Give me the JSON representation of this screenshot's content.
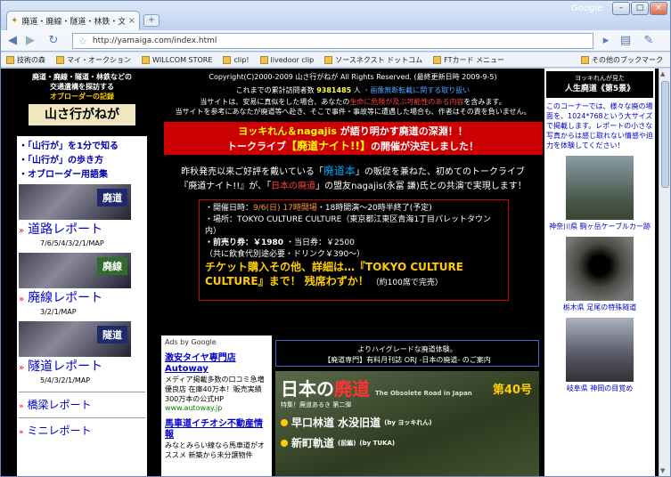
{
  "browser": {
    "tab_title": "廃道・廃線・隧道・林鉄・文…",
    "tab_close": "×",
    "new_tab": "+",
    "brand": "Google",
    "win_min": "–",
    "win_max": "□",
    "win_close": "×",
    "url": "http://yamaiga.com/index.html",
    "bookmarks": [
      "技術の森",
      "マイ・オークション",
      "WILLCOM STORE",
      "clip!",
      "livedoor clip",
      "ソースネクスト ドットコム",
      "FTカード メニュー",
      "その他のブックマーク"
    ]
  },
  "left": {
    "logo_line1": "廃道・廃線・隧道・林鉄などの",
    "logo_line2": "交通遺構を探訪する",
    "logo_orange": "オブローダーの記録",
    "logo_name": "山さ行がねが",
    "links": [
      "・「山行が」を1分で知る",
      "・「山行が」の歩き方",
      "・オブローダー用語集"
    ],
    "cat1": "廃道",
    "rep1": "道路レポート",
    "sub1": "7/6/5/4/3/2/1/MAP",
    "cat2": "廃線",
    "rep2": "廃線レポート",
    "sub2": "3/2/1/MAP",
    "cat3": "隧道",
    "rep3": "隧道レポート",
    "sub3": "5/4/3/2/1/MAP",
    "rep4": "橋梁レポート",
    "rep5": "ミニレポート",
    "marker": "»"
  },
  "center": {
    "copyright": "Copyright(C)2000-2009 山さ行がねが All Rights Reserved. (最終更新日時 2009-9-5)",
    "visitors_pre": "これまでの累計訪問者数",
    "visitors_count": "9381485",
    "visitors_post": "人",
    "visitors_link": "・画像無断転載に関する取り扱い",
    "note1a": "当サイトは、安易に真似をした場合、あなたの",
    "note1b": "生命に危険が及ぶ可能性のある内容",
    "note1c": "を含みます。",
    "note2": "当サイトを参考にあなたが廃道等へ赴き、そこで事件・事故等に遭遇した場合も、作者はその責を負いません。",
    "banner1a": "ヨッキれん＆nagajis",
    "banner1b": "が語り明かす廃道の深淵！！",
    "banner2a": "トークライブ",
    "banner2b": "【廃道ナイト!!】",
    "banner2c": "の開催が決定しました！",
    "intro1a": "昨秋発売以来ご好評を戴いている「",
    "intro1b": "廃道本",
    "intro1c": "」の販促を兼ねた、初めてのトークライブ",
    "intro2a": "『廃道ナイト!!』が、「",
    "intro2b": "日本の廃道",
    "intro2c": "」の盟友nagajis(永冨 謙)氏との共演で実現します！",
    "info_date_a": "・開催日時：",
    "info_date_b": "9/6(日) 17時開場",
    "info_date_c": "・18時開演～20時半終了(予定)",
    "info_place": "・場所：TOKYO CULTURE CULTURE（東京都江東区青海1丁目パレットタウン内）",
    "info_price_a": "・前売り券：￥1980",
    "info_price_b": "・当日券：￥2500",
    "info_price_note": "（共に飲食代別途必要・ドリンク￥390～）",
    "info_ticket_a": "チケット購入その他、詳細は…『TOKYO CULTURE CULTURE』まで！ 残席わずか！",
    "info_ticket_b": "（約100席で完売）",
    "ads_by": "Ads by Google",
    "ad1_title": "激安タイヤ専門店 Autoway",
    "ad1_body": "メディア掲載多数の口コミ急増優良店 在庫40万本！販売実績300万本の公式HP",
    "ad1_url": "www.autoway.jp",
    "ad2_title": "馬車道イチオシ不動産情報",
    "ad2_body": "みなとみらい線なら馬車道がオススメ 新築から未分譲物件",
    "promo1": "よりハイグレードな廃道体験。",
    "promo2": "【廃道専門】有料月刊誌 ORJ -日本の廃道- のご案内",
    "mag_title_a": "日本の",
    "mag_title_b": "廃道",
    "mag_sub": "The Obsolete Road in Japan",
    "mag_no": "第40号",
    "mag_special": "特集！廃道あるき 第二弾",
    "mag_l1": "早口林道 水没旧道",
    "mag_l1_by": "(by ヨッキれん)",
    "mag_l2": "新町軌道",
    "mag_l2_sub": "(前編)",
    "mag_l2_by": "(by TUKA)"
  },
  "right": {
    "head1": "ヨッキれんが見た",
    "head2": "人生廃道《第5景》",
    "text": "このコーナーでは、様々な廃の場面を、1024*768という大サイズで掲載します。レポートの小さな写真からは感じ取れない情感や迫力を体験してください！",
    "cap1": "神奈川県 駒ヶ岳ケーブルカー跡",
    "cap2": "栃木県 足尾の特殊隧道",
    "cap3": "岐阜県 神岡の目覚め"
  }
}
